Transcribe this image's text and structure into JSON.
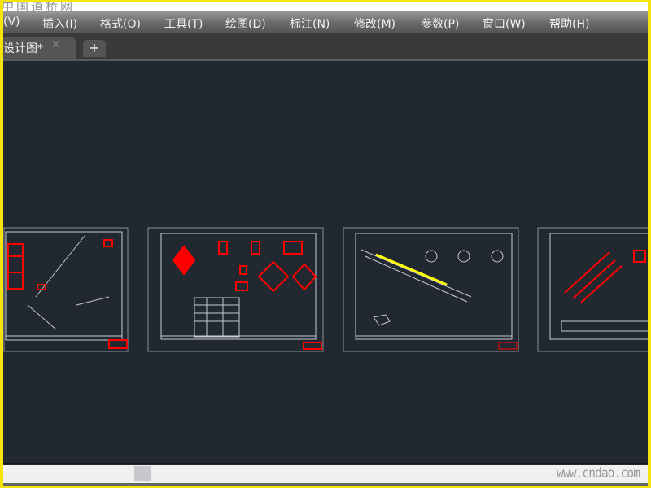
{
  "watermark": "中国道桥网",
  "menu": [
    "(V)",
    "插入(I)",
    "格式(O)",
    "工具(T)",
    "绘图(D)",
    "标注(N)",
    "修改(M)",
    "参数(P)",
    "窗口(W)",
    "帮助(H)"
  ],
  "tab": {
    "label": "设计图*",
    "close": "✕",
    "add": "+"
  },
  "footer_watermark": "www.cndao.com",
  "colors": {
    "canvas": "#212830",
    "drawing_red": "#ff0000",
    "drawing_line": "#ffffff",
    "highlight": "#ffff00"
  },
  "scroll": {
    "horizontal_position_percent": 21
  }
}
